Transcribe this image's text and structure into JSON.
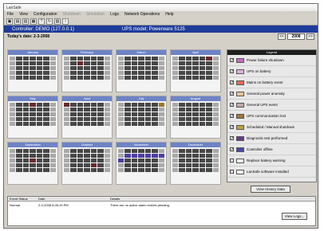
{
  "window": {
    "title": "LanSafe"
  },
  "menu": [
    {
      "label": "File",
      "disabled": false
    },
    {
      "label": "View",
      "disabled": false
    },
    {
      "label": "Configuration",
      "disabled": false
    },
    {
      "label": "Shutdown",
      "disabled": true
    },
    {
      "label": "Simulation",
      "disabled": true
    },
    {
      "label": "Logs",
      "disabled": false
    },
    {
      "label": "Network Operations",
      "disabled": false
    },
    {
      "label": "Help",
      "disabled": false
    }
  ],
  "toolbar_icons": [
    "open-icon",
    "save-icon",
    "print-icon",
    "gear-icon",
    "help-icon",
    "refresh-icon",
    "disk-icon",
    "info-icon"
  ],
  "banner": {
    "controller": "Controller: DEMO (127.0.0.1)",
    "ups": "UPS model: Powerware 5125"
  },
  "date": {
    "today": "Today's date: 2-3-2008",
    "year": "2008",
    "prev": "<<",
    "next": ">>"
  },
  "months": [
    "January",
    "February",
    "March",
    "April",
    "May",
    "June",
    "July",
    "August",
    "September",
    "October",
    "November",
    "December"
  ],
  "legend": {
    "title": "Legend",
    "items": [
      {
        "label": "Power failure shutdown",
        "color": "#c86ac0"
      },
      {
        "label": "UPS on battery",
        "color": "#e0b0e0"
      },
      {
        "label": "Mains on battery event",
        "color": "#e86a5a"
      },
      {
        "label": "General power anomaly",
        "color": "#e8c49a"
      },
      {
        "label": "General UPS event",
        "color": "#c4a8a8"
      },
      {
        "label": "UPS communication lost",
        "color": "#a0783c"
      },
      {
        "label": "Scheduled / Manual shutdown",
        "color": "#c8a040"
      },
      {
        "label": "Diagnostic test performed",
        "color": "#6a3a8a"
      },
      {
        "label": "Controller offline",
        "color": "#4a4ab0"
      },
      {
        "label": "Replace battery warning",
        "color": "#f0f0f0"
      },
      {
        "label": "LanSafe software installed",
        "color": "#f0f0f0"
      }
    ]
  },
  "buttons": {
    "view_history": "View History Data",
    "view_logs": "View Logs..."
  },
  "log": {
    "headers": [
      "Event Status",
      "Date",
      "Details"
    ],
    "rows": [
      {
        "status": "Normal",
        "date": "2-3-2008 8:28:19 PM",
        "details": "There are no active alarm events pending."
      }
    ]
  }
}
